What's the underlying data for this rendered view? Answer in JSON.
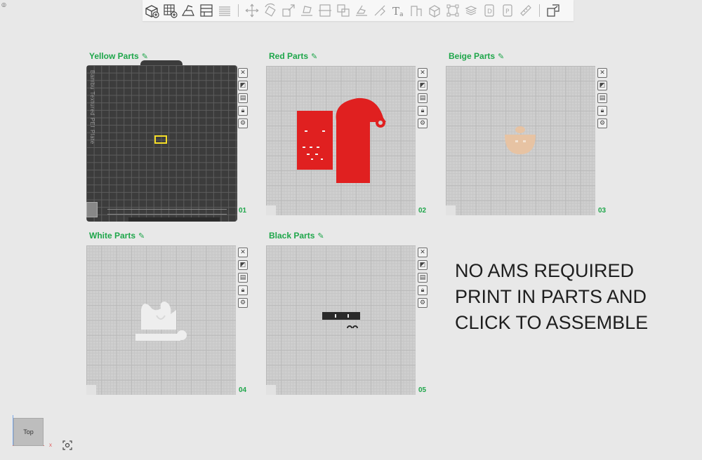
{
  "window": {
    "corner_glyph": "◎"
  },
  "toolbar": {
    "groups": [
      [
        "add-object-icon",
        "arrange-icon",
        "orient-icon",
        "plate-icon",
        "layers-icon"
      ],
      [
        "move-icon",
        "rotate-icon",
        "scale-icon",
        "lay-on-face-icon",
        "cut-icon",
        "split-icon",
        "paint-icon",
        "seam-icon",
        "support-icon",
        "text-icon",
        "measure-icon",
        "assembly-icon",
        "boolean-icon",
        "variable-layer-icon",
        "shell-icon",
        "view-d-icon",
        "view-p-icon",
        "ruler-icon"
      ],
      [
        "assemble-view-icon"
      ]
    ]
  },
  "plates": [
    {
      "title": "Yellow Parts",
      "number": "01",
      "brand": "Bambu Textured PEI Plate",
      "dark": true
    },
    {
      "title": "Red Parts",
      "number": "02"
    },
    {
      "title": "Beige Parts",
      "number": "03"
    },
    {
      "title": "White Parts",
      "number": "04"
    },
    {
      "title": "Black Parts",
      "number": "05"
    }
  ],
  "plate_icons": [
    "close-icon",
    "auto-orient-icon",
    "arrange-plate-icon",
    "lock-icon",
    "settings-icon"
  ],
  "overlay": {
    "lines": [
      "NO AMS REQUIRED",
      "PRINT IN PARTS AND",
      "CLICK TO ASSEMBLE"
    ]
  },
  "view_cube": {
    "label": "Top",
    "axis_x": "x"
  },
  "colors": {
    "accent_green": "#1ea64a",
    "yellow": "#f5dd27",
    "red": "#e02020",
    "beige": "#e7c3a3",
    "white_part": "#eeeeee",
    "black_part": "#2a2a2a"
  }
}
